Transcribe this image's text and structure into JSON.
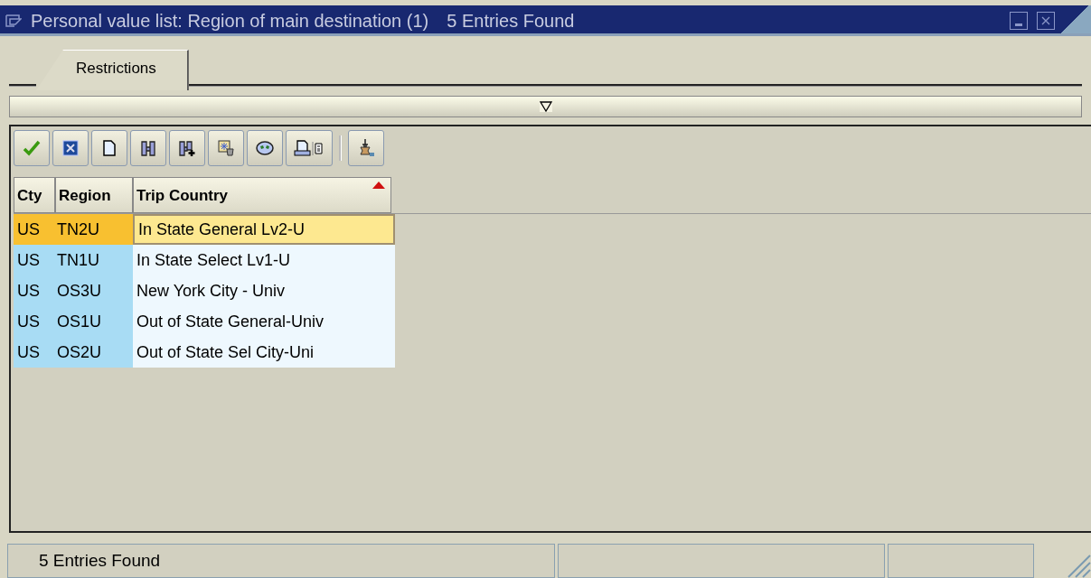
{
  "window": {
    "title": "Personal value list: Region of main destination (1)",
    "subtitle": "5 Entries Found"
  },
  "tabs": [
    {
      "label": "Restrictions",
      "selected": true
    }
  ],
  "toolbar": [
    {
      "kind": "check"
    },
    {
      "kind": "cancel"
    },
    {
      "kind": "new"
    },
    {
      "kind": "find"
    },
    {
      "kind": "find-next"
    },
    {
      "kind": "settings"
    },
    {
      "kind": "globe"
    },
    {
      "kind": "print"
    },
    {
      "kind": "sep"
    },
    {
      "kind": "lamp"
    }
  ],
  "table": {
    "columns": [
      {
        "label": "Cty",
        "sorted": false
      },
      {
        "label": "Region",
        "sorted": false
      },
      {
        "label": "Trip Country",
        "sorted": true
      }
    ],
    "rows": [
      {
        "cells": [
          "US",
          "TN2U",
          "In State General Lv2-U"
        ],
        "selected": true
      },
      {
        "cells": [
          "US",
          "TN1U",
          "In State Select Lv1-U"
        ],
        "selected": false
      },
      {
        "cells": [
          "US",
          "OS3U",
          "New York City - Univ"
        ],
        "selected": false
      },
      {
        "cells": [
          "US",
          "OS1U",
          "Out of State General-Univ"
        ],
        "selected": false
      },
      {
        "cells": [
          "US",
          "OS2U",
          "Out of State Sel City-Uni"
        ],
        "selected": false
      }
    ]
  },
  "status_bar": {
    "message": "5 Entries Found"
  }
}
